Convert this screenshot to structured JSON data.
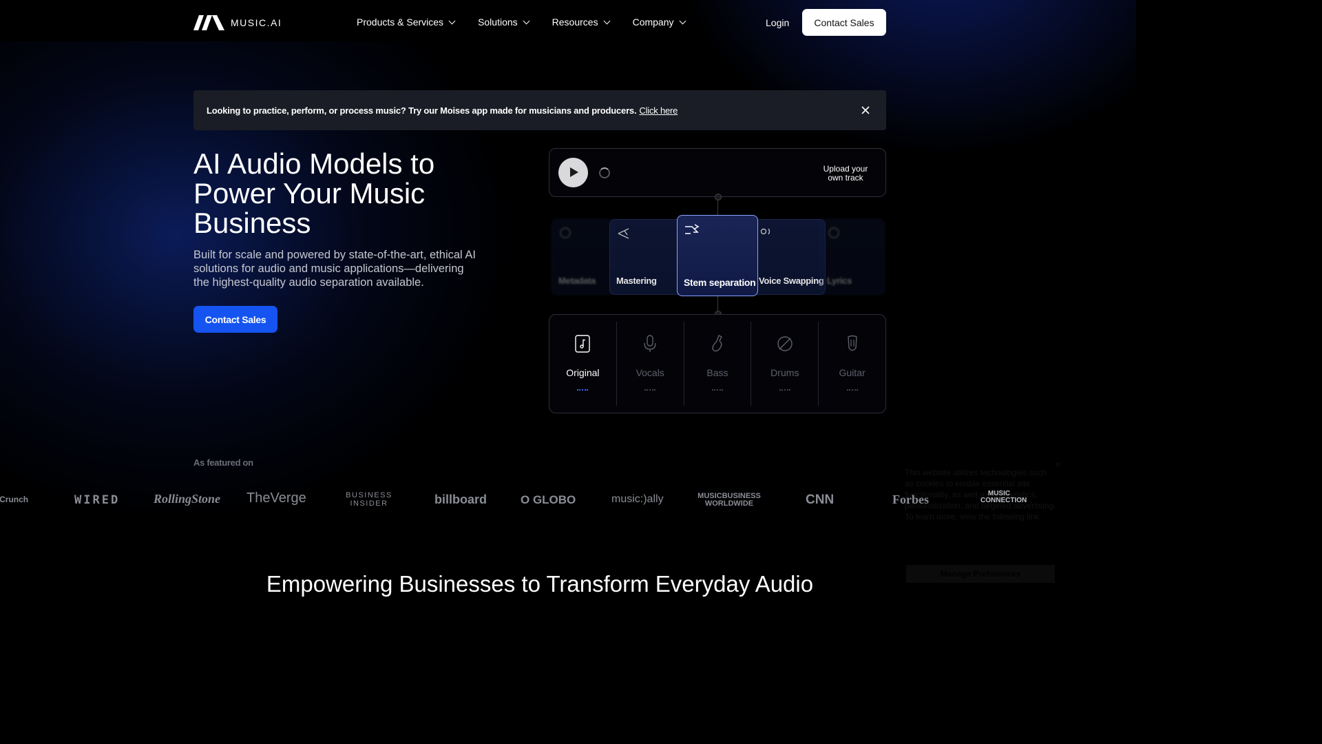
{
  "nav": {
    "brand": "MUSIC.AI",
    "menu": [
      "Products & Services",
      "Solutions",
      "Resources",
      "Company"
    ],
    "login": "Login",
    "cta": "Contact Sales"
  },
  "banner": {
    "text": "Looking to practice, perform, or process music? Try our Moises app made for musicians and producers.",
    "link": "Click here"
  },
  "hero": {
    "title": "AI Audio Models to Power Your Music Business",
    "subtitle": "Built for scale and powered by state-of-the-art, ethical AI solutions for audio and music applications—delivering the highest-quality audio separation available.",
    "cta": "Contact Sales"
  },
  "player": {
    "upload": "Upload your own track"
  },
  "carousel": {
    "cards": [
      "Metadata",
      "Mastering",
      "Stem separation",
      "Voice Swapping",
      "Lyrics"
    ],
    "active": "Stem separation",
    "icons": [
      "info-icon",
      "share-icon",
      "split-icon",
      "voice-icon",
      "info-icon"
    ]
  },
  "stems": {
    "items": [
      "Original",
      "Vocals",
      "Bass",
      "Drums",
      "Guitar"
    ],
    "active": "Original",
    "icons": [
      "music-file-icon",
      "microphone-icon",
      "bass-icon",
      "drum-icon",
      "guitar-icon"
    ]
  },
  "featured": {
    "label": "As featured on",
    "logos": [
      "TechCrunch",
      "WIRED",
      "RollingStone",
      "TheVerge",
      "BUSINESS INSIDER",
      "billboard",
      "O GLOBO",
      "music:)ally",
      "MUSICBUSINESS WORLDWIDE",
      "CNN",
      "Forbes",
      "MUSIC CONNECTION"
    ]
  },
  "cookie": {
    "text": "This website utilizes technologies such as cookies to enable essential site functionality, as well as for analytics, personalization, and targeted advertising. To learn more, view the following link",
    "button": "Manage Preferences",
    "close": "×"
  },
  "section": {
    "title": "Empowering Businesses to Transform Everyday Audio"
  },
  "colors": {
    "accent": "#1554f0",
    "active_border": "#8aa4ff"
  }
}
